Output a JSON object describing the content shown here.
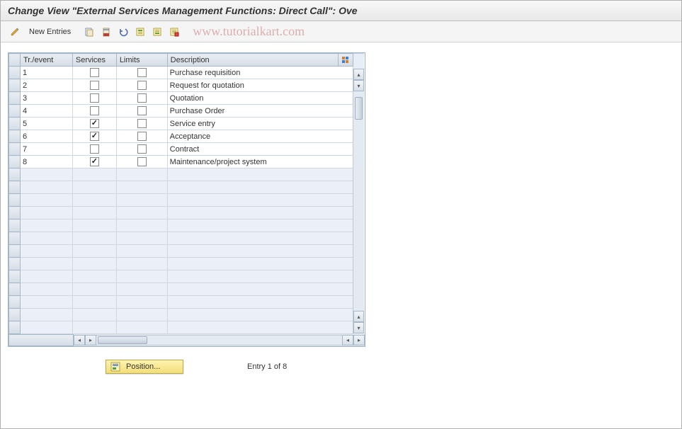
{
  "title": "Change View \"External Services Management Functions: Direct Call\": Ove",
  "toolbar": {
    "new_entries": "New Entries"
  },
  "watermark": "www.tutorialkart.com",
  "columns": {
    "tr_event": "Tr./event",
    "services": "Services",
    "limits": "Limits",
    "description": "Description"
  },
  "rows": [
    {
      "tr": "1",
      "services": false,
      "limits": false,
      "desc": "Purchase requisition"
    },
    {
      "tr": "2",
      "services": false,
      "limits": false,
      "desc": "Request for quotation"
    },
    {
      "tr": "3",
      "services": false,
      "limits": false,
      "desc": "Quotation"
    },
    {
      "tr": "4",
      "services": false,
      "limits": false,
      "desc": "Purchase Order"
    },
    {
      "tr": "5",
      "services": true,
      "limits": false,
      "desc": "Service entry"
    },
    {
      "tr": "6",
      "services": true,
      "limits": false,
      "desc": "Acceptance"
    },
    {
      "tr": "7",
      "services": false,
      "limits": false,
      "desc": "Contract"
    },
    {
      "tr": "8",
      "services": true,
      "limits": false,
      "desc": "Maintenance/project system"
    }
  ],
  "empty_rows": 13,
  "footer": {
    "position_label": "Position...",
    "entry_text": "Entry 1 of 8"
  }
}
